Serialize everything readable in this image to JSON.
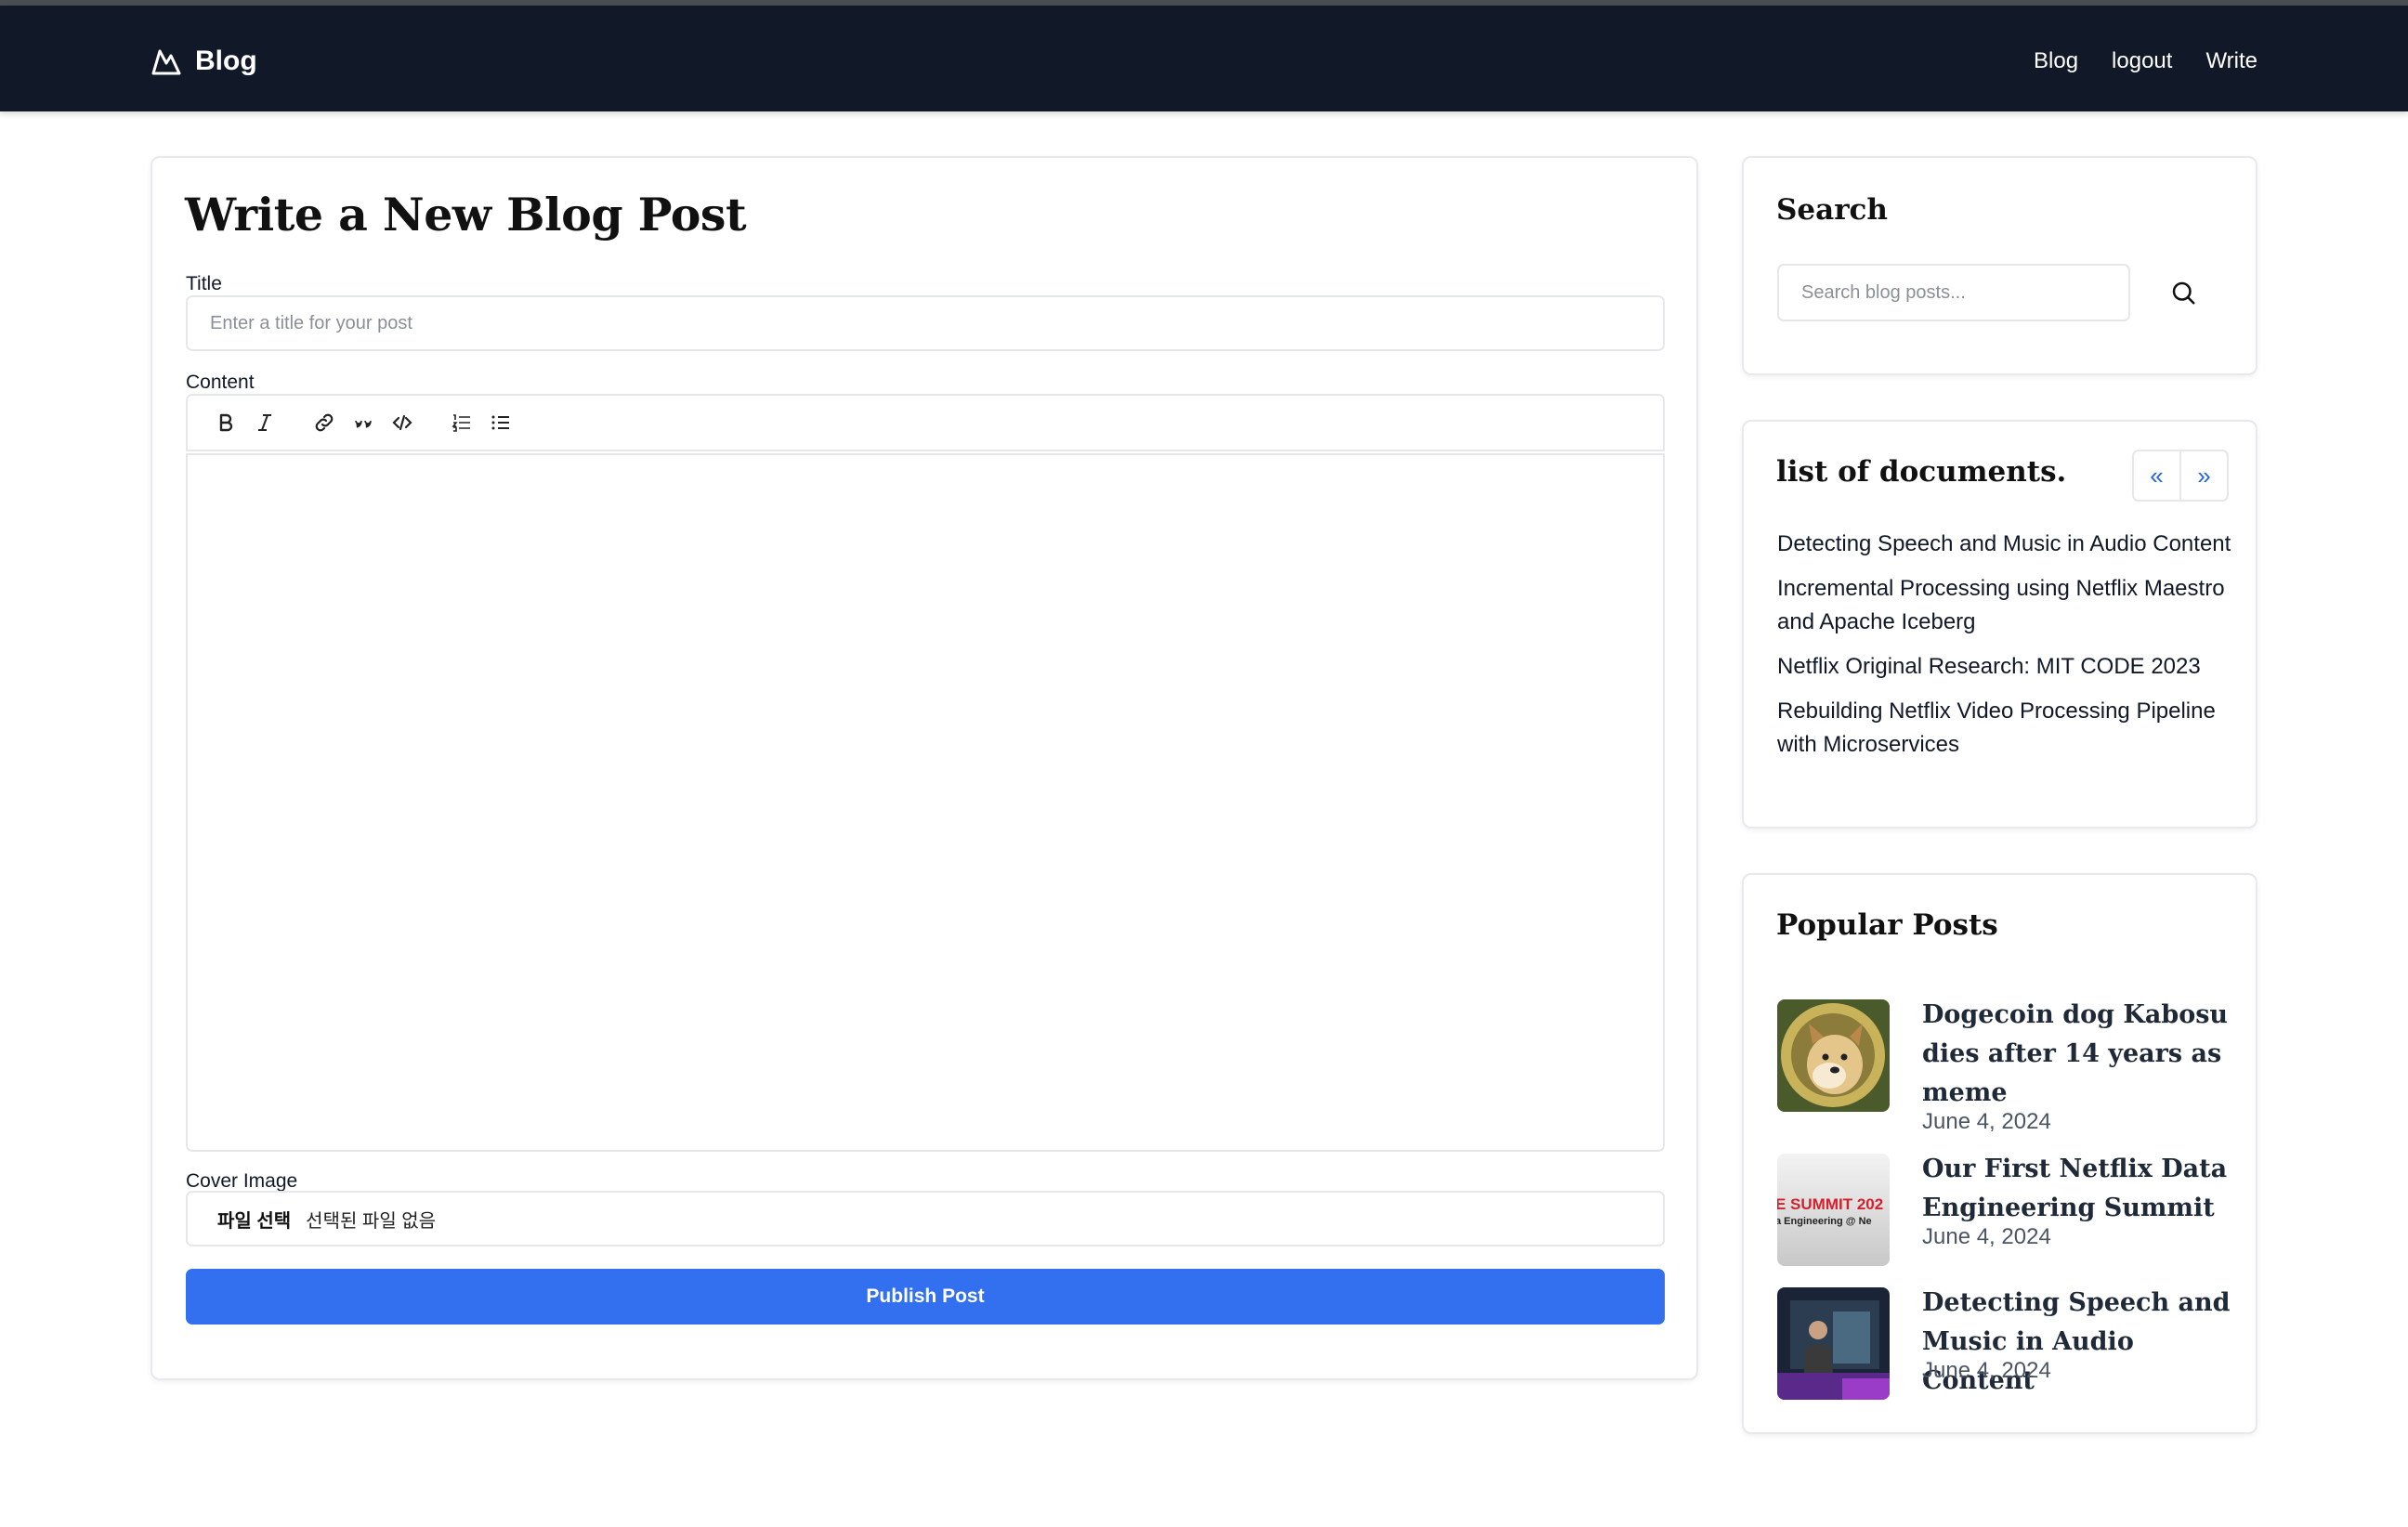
{
  "header": {
    "brand": "Blog",
    "nav": [
      "Blog",
      "logout",
      "Write"
    ]
  },
  "editor": {
    "title": "Write a New Blog Post",
    "title_label": "Title",
    "title_placeholder": "Enter a title for your post",
    "content_label": "Content",
    "toolbar": [
      "bold-icon",
      "italic-icon",
      "link-icon",
      "quote-icon",
      "code-icon",
      "ordered-list-icon",
      "bullet-list-icon"
    ],
    "cover_label": "Cover Image",
    "file_button": "파일 선택",
    "file_status": "선택된 파일 없음",
    "publish": "Publish Post"
  },
  "search": {
    "title": "Search",
    "placeholder": "Search blog posts..."
  },
  "documents": {
    "title": "list of documents.",
    "prev": "«",
    "next": "»",
    "items": [
      "Detecting Speech and Music in Audio Content",
      "Incremental Processing using Netflix Maestro and Apache Iceberg",
      "Netflix Original Research: MIT CODE 2023",
      "Rebuilding Netflix Video Processing Pipeline with Microservices"
    ]
  },
  "popular": {
    "title": "Popular Posts",
    "posts": [
      {
        "title": "Dogecoin dog Kabosu dies after 14 years as meme",
        "date": "June 4, 2024"
      },
      {
        "title": "Our First Netflix Data Engineering Summit",
        "date": "June 4, 2024",
        "thumb_text": [
          "E SUMMIT 202",
          "a Engineering @ Ne"
        ]
      },
      {
        "title": "Detecting Speech and Music in Audio Content",
        "date": "June 4, 2024"
      }
    ]
  }
}
